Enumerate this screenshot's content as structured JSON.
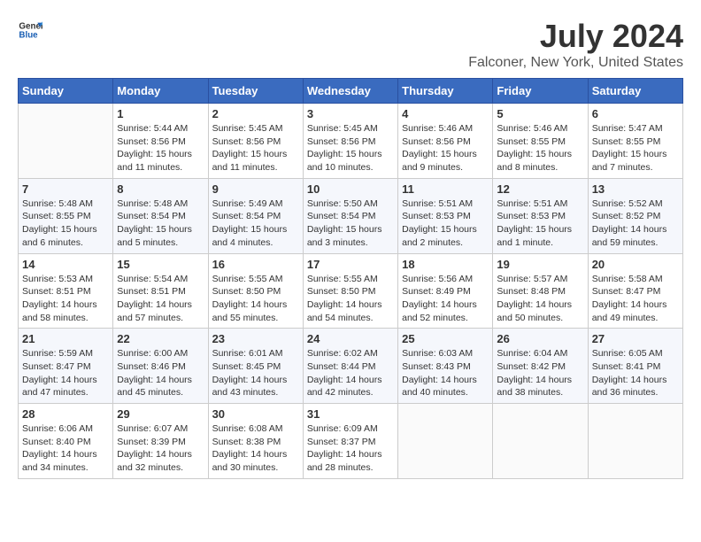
{
  "header": {
    "logo_general": "General",
    "logo_blue": "Blue",
    "title": "July 2024",
    "subtitle": "Falconer, New York, United States"
  },
  "weekdays": [
    "Sunday",
    "Monday",
    "Tuesday",
    "Wednesday",
    "Thursday",
    "Friday",
    "Saturday"
  ],
  "weeks": [
    [
      {
        "day": "",
        "info": ""
      },
      {
        "day": "1",
        "info": "Sunrise: 5:44 AM\nSunset: 8:56 PM\nDaylight: 15 hours\nand 11 minutes."
      },
      {
        "day": "2",
        "info": "Sunrise: 5:45 AM\nSunset: 8:56 PM\nDaylight: 15 hours\nand 11 minutes."
      },
      {
        "day": "3",
        "info": "Sunrise: 5:45 AM\nSunset: 8:56 PM\nDaylight: 15 hours\nand 10 minutes."
      },
      {
        "day": "4",
        "info": "Sunrise: 5:46 AM\nSunset: 8:56 PM\nDaylight: 15 hours\nand 9 minutes."
      },
      {
        "day": "5",
        "info": "Sunrise: 5:46 AM\nSunset: 8:55 PM\nDaylight: 15 hours\nand 8 minutes."
      },
      {
        "day": "6",
        "info": "Sunrise: 5:47 AM\nSunset: 8:55 PM\nDaylight: 15 hours\nand 7 minutes."
      }
    ],
    [
      {
        "day": "7",
        "info": "Sunrise: 5:48 AM\nSunset: 8:55 PM\nDaylight: 15 hours\nand 6 minutes."
      },
      {
        "day": "8",
        "info": "Sunrise: 5:48 AM\nSunset: 8:54 PM\nDaylight: 15 hours\nand 5 minutes."
      },
      {
        "day": "9",
        "info": "Sunrise: 5:49 AM\nSunset: 8:54 PM\nDaylight: 15 hours\nand 4 minutes."
      },
      {
        "day": "10",
        "info": "Sunrise: 5:50 AM\nSunset: 8:54 PM\nDaylight: 15 hours\nand 3 minutes."
      },
      {
        "day": "11",
        "info": "Sunrise: 5:51 AM\nSunset: 8:53 PM\nDaylight: 15 hours\nand 2 minutes."
      },
      {
        "day": "12",
        "info": "Sunrise: 5:51 AM\nSunset: 8:53 PM\nDaylight: 15 hours\nand 1 minute."
      },
      {
        "day": "13",
        "info": "Sunrise: 5:52 AM\nSunset: 8:52 PM\nDaylight: 14 hours\nand 59 minutes."
      }
    ],
    [
      {
        "day": "14",
        "info": "Sunrise: 5:53 AM\nSunset: 8:51 PM\nDaylight: 14 hours\nand 58 minutes."
      },
      {
        "day": "15",
        "info": "Sunrise: 5:54 AM\nSunset: 8:51 PM\nDaylight: 14 hours\nand 57 minutes."
      },
      {
        "day": "16",
        "info": "Sunrise: 5:55 AM\nSunset: 8:50 PM\nDaylight: 14 hours\nand 55 minutes."
      },
      {
        "day": "17",
        "info": "Sunrise: 5:55 AM\nSunset: 8:50 PM\nDaylight: 14 hours\nand 54 minutes."
      },
      {
        "day": "18",
        "info": "Sunrise: 5:56 AM\nSunset: 8:49 PM\nDaylight: 14 hours\nand 52 minutes."
      },
      {
        "day": "19",
        "info": "Sunrise: 5:57 AM\nSunset: 8:48 PM\nDaylight: 14 hours\nand 50 minutes."
      },
      {
        "day": "20",
        "info": "Sunrise: 5:58 AM\nSunset: 8:47 PM\nDaylight: 14 hours\nand 49 minutes."
      }
    ],
    [
      {
        "day": "21",
        "info": "Sunrise: 5:59 AM\nSunset: 8:47 PM\nDaylight: 14 hours\nand 47 minutes."
      },
      {
        "day": "22",
        "info": "Sunrise: 6:00 AM\nSunset: 8:46 PM\nDaylight: 14 hours\nand 45 minutes."
      },
      {
        "day": "23",
        "info": "Sunrise: 6:01 AM\nSunset: 8:45 PM\nDaylight: 14 hours\nand 43 minutes."
      },
      {
        "day": "24",
        "info": "Sunrise: 6:02 AM\nSunset: 8:44 PM\nDaylight: 14 hours\nand 42 minutes."
      },
      {
        "day": "25",
        "info": "Sunrise: 6:03 AM\nSunset: 8:43 PM\nDaylight: 14 hours\nand 40 minutes."
      },
      {
        "day": "26",
        "info": "Sunrise: 6:04 AM\nSunset: 8:42 PM\nDaylight: 14 hours\nand 38 minutes."
      },
      {
        "day": "27",
        "info": "Sunrise: 6:05 AM\nSunset: 8:41 PM\nDaylight: 14 hours\nand 36 minutes."
      }
    ],
    [
      {
        "day": "28",
        "info": "Sunrise: 6:06 AM\nSunset: 8:40 PM\nDaylight: 14 hours\nand 34 minutes."
      },
      {
        "day": "29",
        "info": "Sunrise: 6:07 AM\nSunset: 8:39 PM\nDaylight: 14 hours\nand 32 minutes."
      },
      {
        "day": "30",
        "info": "Sunrise: 6:08 AM\nSunset: 8:38 PM\nDaylight: 14 hours\nand 30 minutes."
      },
      {
        "day": "31",
        "info": "Sunrise: 6:09 AM\nSunset: 8:37 PM\nDaylight: 14 hours\nand 28 minutes."
      },
      {
        "day": "",
        "info": ""
      },
      {
        "day": "",
        "info": ""
      },
      {
        "day": "",
        "info": ""
      }
    ]
  ]
}
